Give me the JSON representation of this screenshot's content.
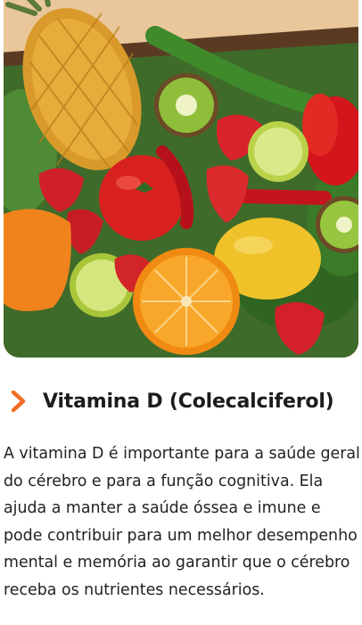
{
  "image": {
    "alt_icon": "fruits-and-vegetables-photo"
  },
  "section": {
    "icon": "chevron-right-icon",
    "title": "Vitamina D (Colecalciferol)",
    "accent_color": "#f26b22",
    "description": "A vitamina D é importante para a saúde geral do cérebro e para a função cognitiva. Ela ajuda a manter a saúde óssea e imune e pode contribuir para um melhor desempenho mental e memória ao garantir que o cérebro receba os nutrientes necessários."
  }
}
